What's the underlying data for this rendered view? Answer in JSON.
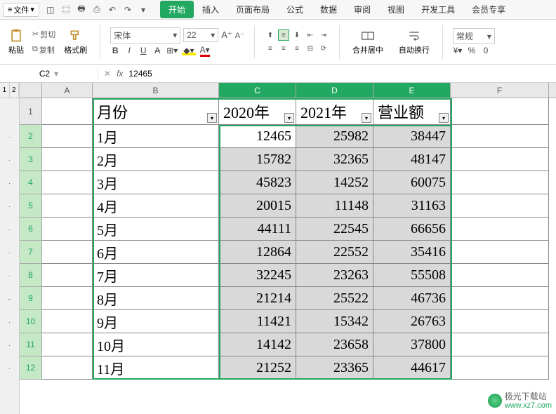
{
  "menu": {
    "file_label": "文件",
    "tabs": [
      "开始",
      "插入",
      "页面布局",
      "公式",
      "数据",
      "审阅",
      "视图",
      "开发工具",
      "会员专享"
    ],
    "active_tab": 0
  },
  "toolbar": {
    "cut": "剪切",
    "copy": "复制",
    "paste": "粘贴",
    "format_painter": "格式刷",
    "font_name": "宋体",
    "font_size": "22",
    "merge_center": "合并居中",
    "auto_wrap": "自动换行",
    "number_format": "常规"
  },
  "namebox": {
    "ref": "C2",
    "formula": "12465"
  },
  "columns": [
    "A",
    "B",
    "C",
    "D",
    "E",
    "F"
  ],
  "selected_cols": [
    "C",
    "D",
    "E"
  ],
  "selected_rows": [
    2,
    3,
    4,
    5,
    6,
    7,
    8,
    9,
    10,
    11,
    12
  ],
  "table": {
    "headers": {
      "B": "月份",
      "C": "2020年",
      "D": "2021年",
      "E": "营业额"
    },
    "rows": [
      {
        "r": 2,
        "B": "1月",
        "C": "12465",
        "D": "25982",
        "E": "38447"
      },
      {
        "r": 3,
        "B": "2月",
        "C": "15782",
        "D": "32365",
        "E": "48147"
      },
      {
        "r": 4,
        "B": "3月",
        "C": "45823",
        "D": "14252",
        "E": "60075"
      },
      {
        "r": 5,
        "B": "4月",
        "C": "20015",
        "D": "11148",
        "E": "31163"
      },
      {
        "r": 6,
        "B": "5月",
        "C": "44111",
        "D": "22545",
        "E": "66656"
      },
      {
        "r": 7,
        "B": "6月",
        "C": "12864",
        "D": "22552",
        "E": "35416"
      },
      {
        "r": 8,
        "B": "7月",
        "C": "32245",
        "D": "23263",
        "E": "55508"
      },
      {
        "r": 9,
        "B": "8月",
        "C": "21214",
        "D": "25522",
        "E": "46736"
      },
      {
        "r": 10,
        "B": "9月",
        "C": "11421",
        "D": "15342",
        "E": "26763"
      },
      {
        "r": 11,
        "B": "10月",
        "C": "14142",
        "D": "23658",
        "E": "37800"
      },
      {
        "r": 12,
        "B": "11月",
        "C": "21252",
        "D": "23365",
        "E": "44617"
      }
    ]
  },
  "watermark": {
    "name": "极光下载站",
    "url": "www.xz7.com"
  },
  "chart_data": {
    "type": "table",
    "title": "营业额",
    "columns": [
      "月份",
      "2020年",
      "2021年",
      "营业额"
    ],
    "rows": [
      [
        "1月",
        12465,
        25982,
        38447
      ],
      [
        "2月",
        15782,
        32365,
        48147
      ],
      [
        "3月",
        45823,
        14252,
        60075
      ],
      [
        "4月",
        20015,
        11148,
        31163
      ],
      [
        "5月",
        44111,
        22545,
        66656
      ],
      [
        "6月",
        12864,
        22552,
        35416
      ],
      [
        "7月",
        32245,
        23263,
        55508
      ],
      [
        "8月",
        21214,
        25522,
        46736
      ],
      [
        "9月",
        11421,
        15342,
        26763
      ],
      [
        "10月",
        14142,
        23658,
        37800
      ],
      [
        "11月",
        21252,
        23365,
        44617
      ]
    ]
  }
}
